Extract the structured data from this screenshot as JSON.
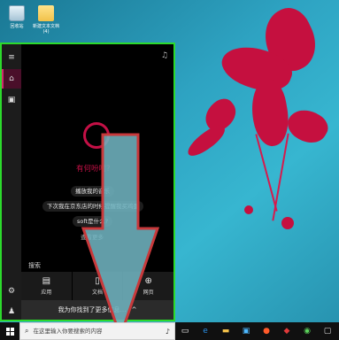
{
  "desktop": {
    "icons": [
      {
        "label": "回收站",
        "icon": "recycle-bin-icon"
      },
      {
        "label": "新建文本文档(4)",
        "icon": "folder-icon"
      }
    ]
  },
  "cortana": {
    "greeting": "有何吩咐?",
    "suggestions": [
      "播放我的音乐",
      "下次我在京东店的时候提醒我买鸡蛋",
      "soft是什么?",
      "查看更多"
    ],
    "search_section_label": "搜索",
    "categories": [
      {
        "label": "应用",
        "icon": "app-icon"
      },
      {
        "label": "文档",
        "icon": "document-icon"
      },
      {
        "label": "网页",
        "icon": "web-icon"
      }
    ],
    "found_bar_label": "我为你找到了更多信息…",
    "found_bar_chevron": "^"
  },
  "taskbar": {
    "search_placeholder": "在这里输入你要搜索的内容"
  },
  "colors": {
    "accent": "#c41046",
    "highlight_border": "#2cda2c",
    "arrow_fill": "#6fb3bf",
    "arrow_stroke": "#c8393b"
  }
}
